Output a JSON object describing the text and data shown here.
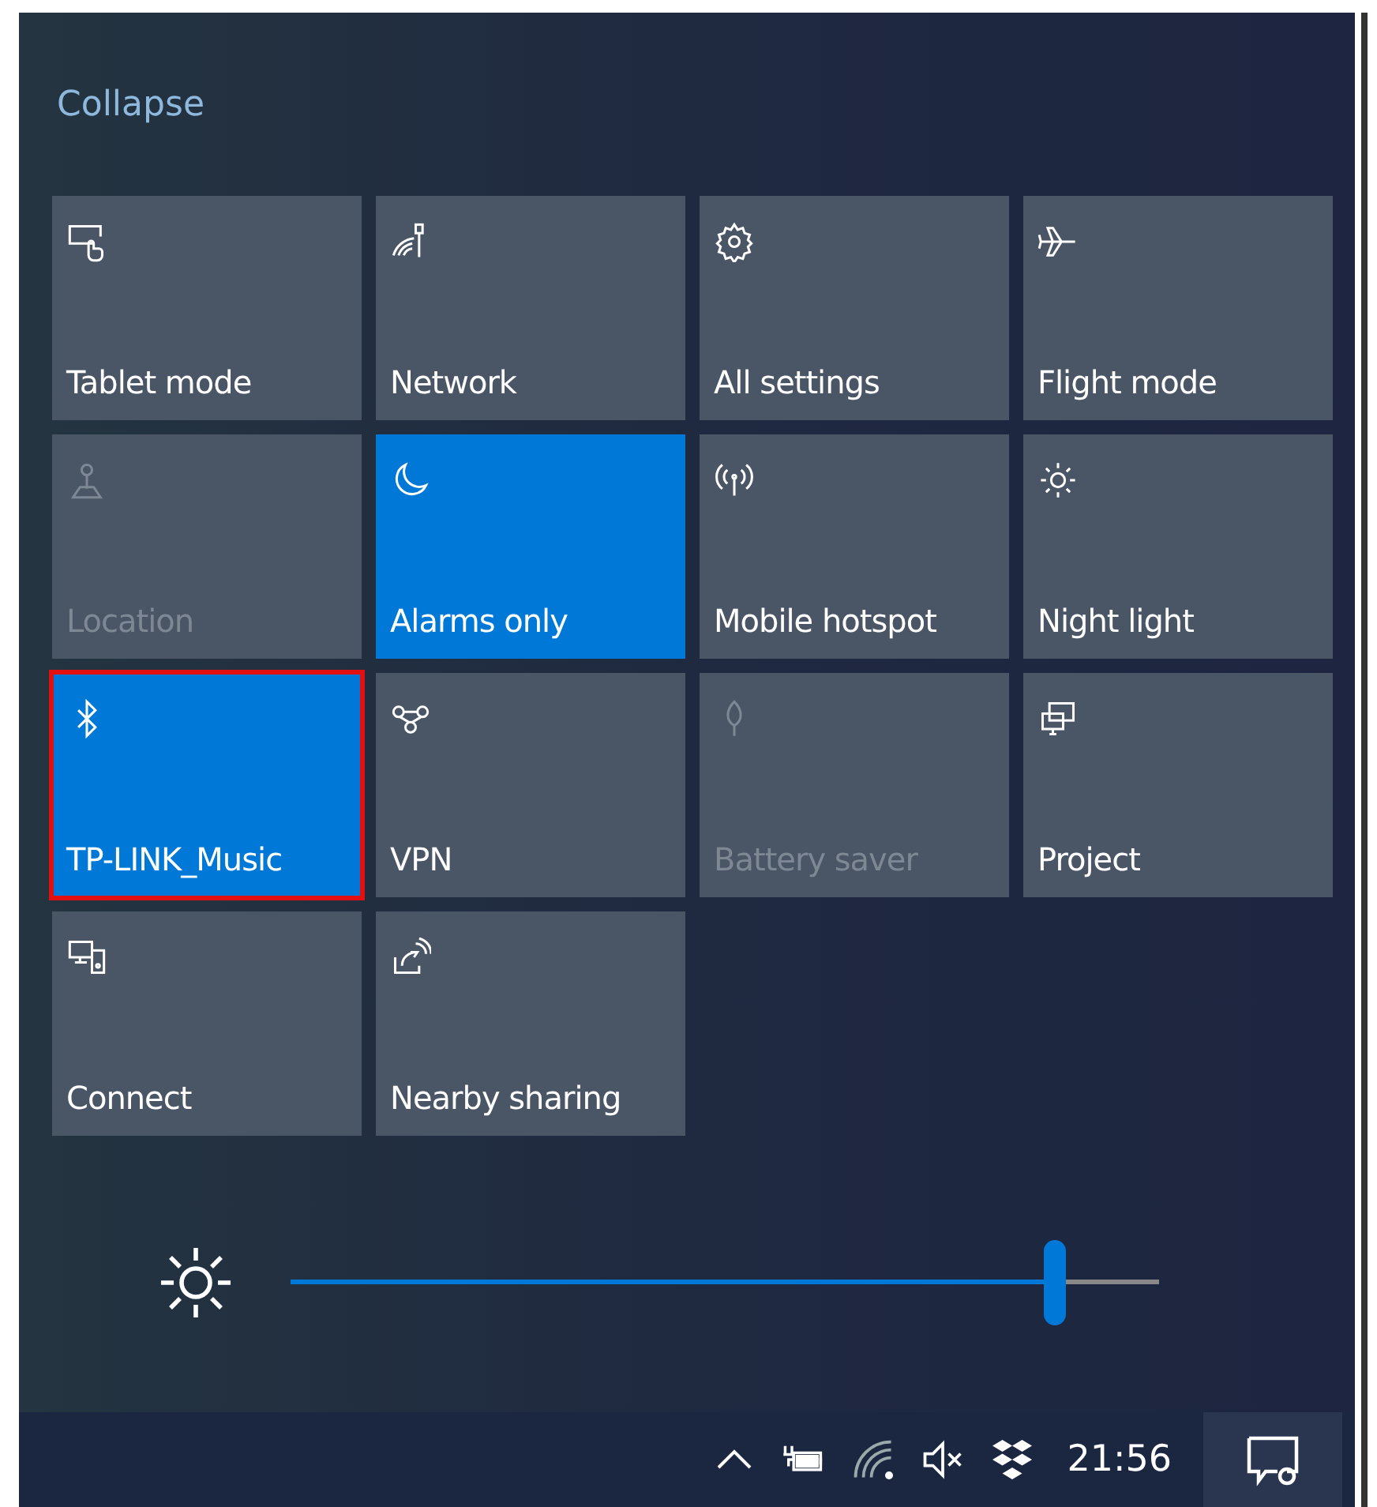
{
  "collapse_link": "Collapse",
  "tiles": [
    {
      "label": "Tablet mode",
      "on": false,
      "disabled": false,
      "highlighted": false
    },
    {
      "label": "Network",
      "on": false,
      "disabled": false,
      "highlighted": false
    },
    {
      "label": "All settings",
      "on": false,
      "disabled": false,
      "highlighted": false
    },
    {
      "label": "Flight mode",
      "on": false,
      "disabled": false,
      "highlighted": false
    },
    {
      "label": "Location",
      "on": false,
      "disabled": true,
      "highlighted": false
    },
    {
      "label": "Alarms only",
      "on": true,
      "disabled": false,
      "highlighted": false
    },
    {
      "label": "Mobile hotspot",
      "on": false,
      "disabled": false,
      "highlighted": false
    },
    {
      "label": "Night light",
      "on": false,
      "disabled": false,
      "highlighted": false
    },
    {
      "label": "TP-LINK_Music",
      "on": true,
      "disabled": false,
      "highlighted": true
    },
    {
      "label": "VPN",
      "on": false,
      "disabled": false,
      "highlighted": false
    },
    {
      "label": "Battery saver",
      "on": false,
      "disabled": true,
      "highlighted": false
    },
    {
      "label": "Project",
      "on": false,
      "disabled": false,
      "highlighted": false
    },
    {
      "label": "Connect",
      "on": false,
      "disabled": false,
      "highlighted": false
    },
    {
      "label": "Nearby sharing",
      "on": false,
      "disabled": false,
      "highlighted": false
    }
  ],
  "brightness": {
    "level": 0.88
  },
  "taskbar": {
    "volume_muted": true,
    "time": "21:56"
  }
}
